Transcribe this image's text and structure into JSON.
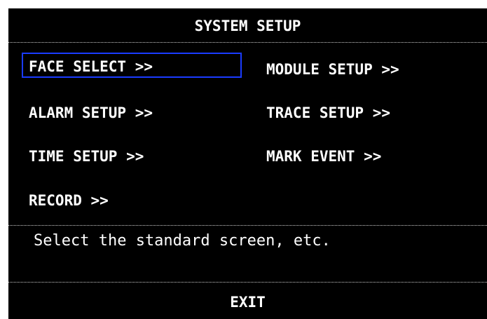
{
  "dialog": {
    "title": "SYSTEM SETUP",
    "menu": [
      {
        "label": "FACE SELECT >>",
        "selected": true
      },
      {
        "label": "MODULE SETUP >>",
        "selected": false
      },
      {
        "label": "ALARM SETUP >>",
        "selected": false
      },
      {
        "label": "TRACE SETUP >>",
        "selected": false
      },
      {
        "label": "TIME SETUP >>",
        "selected": false
      },
      {
        "label": "MARK EVENT >>",
        "selected": false
      },
      {
        "label": "RECORD >>",
        "selected": false
      }
    ],
    "status_text": "Select the standard screen, etc.",
    "exit_label": "EXIT"
  },
  "colors": {
    "background": "#000000",
    "text": "#ffffff",
    "selection_border": "#1a3cff"
  }
}
